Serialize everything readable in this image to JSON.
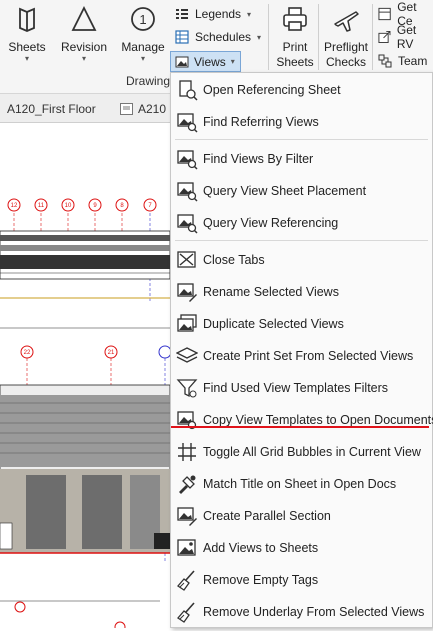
{
  "ribbon": {
    "sheets_label": "Sheets",
    "revision_label": "Revision",
    "manage_label": "Manage",
    "legends_label": "Legends",
    "schedules_label": "Schedules",
    "views_label": "Views",
    "print_sheets_label": [
      "Print",
      "Sheets"
    ],
    "preflight_label": [
      "Preflight",
      "Checks"
    ],
    "get_ce_label": "Get Ce",
    "get_rv_label": "Get RV",
    "team_label": "Team",
    "group_drawing": "Drawing"
  },
  "tabs": [
    {
      "label": "A120_First Floor"
    },
    {
      "label": "A210"
    }
  ],
  "drawing": {
    "grid_bubbles_top": [
      "12",
      "11",
      "10",
      "9",
      "8",
      "7"
    ],
    "grid_bubbles_mid": [
      "22",
      "21"
    ]
  },
  "menu": {
    "items": [
      {
        "label": "Open Referencing Sheet",
        "icon": "sheet-link-icon"
      },
      {
        "label": "Find Referring Views",
        "icon": "find-view-icon"
      },
      {
        "label": "Find Views By Filter",
        "icon": "filter-view-icon"
      },
      {
        "label": "Query View Sheet Placement",
        "icon": "query-view-icon"
      },
      {
        "label": "Query View Referencing",
        "icon": "query-ref-icon"
      },
      {
        "label": "Close Tabs",
        "icon": "close-tabs-icon"
      },
      {
        "label": "Rename Selected Views",
        "icon": "rename-icon"
      },
      {
        "label": "Duplicate Selected Views",
        "icon": "duplicate-icon"
      },
      {
        "label": "Create Print Set From Selected Views",
        "icon": "layers-icon"
      },
      {
        "label": "Find Used View Templates Filters",
        "icon": "funnel-icon"
      },
      {
        "label": "Copy View Templates to Open Documents",
        "icon": "copy-template-icon"
      },
      {
        "label": "Toggle All Grid Bubbles in Current View",
        "icon": "grid-icon"
      },
      {
        "label": "Match Title on Sheet in Open Docs",
        "icon": "match-title-icon"
      },
      {
        "label": "Create Parallel Section",
        "icon": "section-icon"
      },
      {
        "label": "Add Views to Sheets",
        "icon": "add-views-icon"
      },
      {
        "label": "Remove Empty Tags",
        "icon": "broom-icon"
      },
      {
        "label": "Remove Underlay From Selected Views",
        "icon": "broom-underlay-icon"
      }
    ]
  }
}
